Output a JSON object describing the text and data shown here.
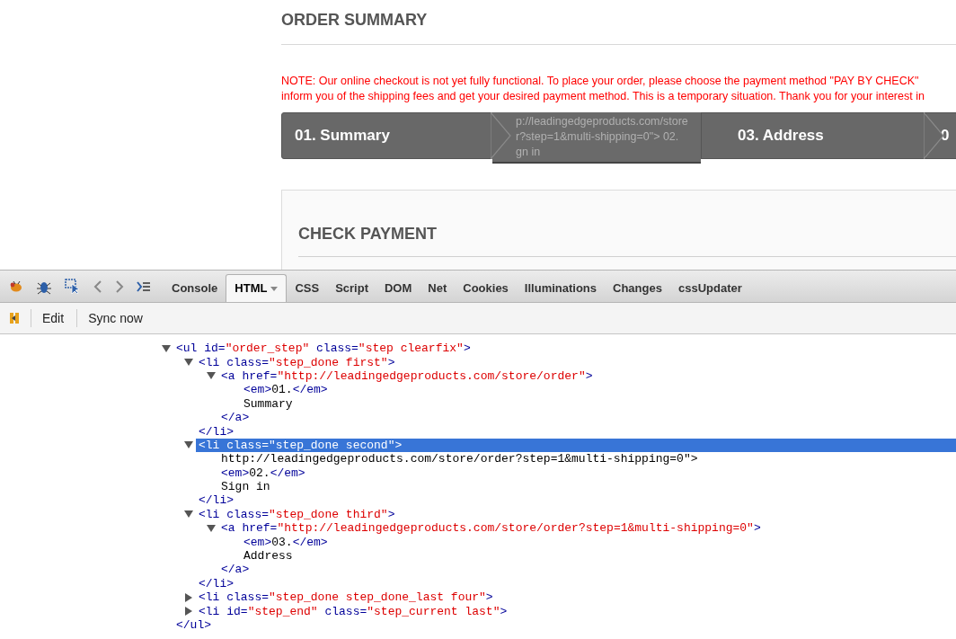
{
  "page": {
    "title": "ORDER SUMMARY",
    "note_lines": [
      "NOTE: Our online checkout is not yet fully functional. To place your order, please choose the payment method \"PAY BY CHECK\"",
      "inform you of the shipping fees and get your desired payment method. This is a temporary situation. Thank you for your interest in"
    ],
    "steps": [
      {
        "kind": "step",
        "lines": [
          "01. Summary"
        ]
      },
      {
        "kind": "overlay",
        "lines": [
          "p://leadingedgeproducts.com/store",
          "r?step=1&multi-shipping=0\"> 02.",
          "gn in"
        ]
      },
      {
        "kind": "step",
        "lines": [
          "03. Address"
        ]
      },
      {
        "kind": "step",
        "lines": [
          "0"
        ]
      }
    ],
    "panel": {
      "title": "CHECK PAYMENT"
    }
  },
  "devtools": {
    "tabs": [
      {
        "label": "Console",
        "selected": false,
        "menu": false
      },
      {
        "label": "HTML",
        "selected": true,
        "menu": true
      },
      {
        "label": "CSS",
        "selected": false,
        "menu": false
      },
      {
        "label": "Script",
        "selected": false,
        "menu": false
      },
      {
        "label": "DOM",
        "selected": false,
        "menu": false
      },
      {
        "label": "Net",
        "selected": false,
        "menu": false
      },
      {
        "label": "Cookies",
        "selected": false,
        "menu": false
      },
      {
        "label": "Illuminations",
        "selected": false,
        "menu": false
      },
      {
        "label": "Changes",
        "selected": false,
        "menu": false
      },
      {
        "label": "cssUpdater",
        "selected": false,
        "menu": false
      }
    ],
    "subtoolbar": [
      "Edit",
      "Sync now"
    ],
    "tree": [
      {
        "expanded": true,
        "selected": false,
        "tokens": [
          {
            "kind": "tag",
            "text": "<ul"
          },
          {
            "kind": "attr",
            "text": " id="
          },
          {
            "kind": "value",
            "text": "\"order_step\""
          },
          {
            "kind": "attr",
            "text": " class="
          },
          {
            "kind": "value",
            "text": "\"step clearfix\""
          },
          {
            "kind": "tag",
            "text": ">"
          }
        ],
        "close": [
          {
            "kind": "tag",
            "text": "</ul>"
          }
        ],
        "children": [
          {
            "expanded": true,
            "selected": false,
            "tokens": [
              {
                "kind": "tag",
                "text": "<li"
              },
              {
                "kind": "attr",
                "text": " class="
              },
              {
                "kind": "value",
                "text": "\"step_done first\""
              },
              {
                "kind": "tag",
                "text": ">"
              }
            ],
            "close": [
              {
                "kind": "tag",
                "text": "</li>"
              }
            ],
            "children": [
              {
                "expanded": true,
                "selected": false,
                "tokens": [
                  {
                    "kind": "tag",
                    "text": "<a"
                  },
                  {
                    "kind": "attr",
                    "text": " href="
                  },
                  {
                    "kind": "value",
                    "text": "\"http://leadingedgeproducts.com/store/order\""
                  },
                  {
                    "kind": "tag",
                    "text": ">"
                  }
                ],
                "close": [
                  {
                    "kind": "tag",
                    "text": "</a>"
                  }
                ],
                "children": [
                  {
                    "tokens": [
                      {
                        "kind": "tag",
                        "text": "<em>"
                      },
                      {
                        "kind": "text",
                        "text": "01."
                      },
                      {
                        "kind": "tag",
                        "text": "</em>"
                      }
                    ]
                  },
                  {
                    "tokens": [
                      {
                        "kind": "text",
                        "text": "Summary"
                      }
                    ]
                  }
                ]
              }
            ]
          },
          {
            "expanded": true,
            "selected": true,
            "tokens": [
              {
                "kind": "tag",
                "text": "<li"
              },
              {
                "kind": "attr",
                "text": " class="
              },
              {
                "kind": "value",
                "text": "\"step_done second\""
              },
              {
                "kind": "tag",
                "text": ">"
              }
            ],
            "close": [
              {
                "kind": "tag",
                "text": "</li>"
              }
            ],
            "children": [
              {
                "tokens": [
                  {
                    "kind": "text",
                    "text": "http://leadingedgeproducts.com/store/order?step=1&multi-shipping=0\">"
                  }
                ]
              },
              {
                "tokens": [
                  {
                    "kind": "tag",
                    "text": "<em>"
                  },
                  {
                    "kind": "text",
                    "text": "02."
                  },
                  {
                    "kind": "tag",
                    "text": "</em>"
                  }
                ]
              },
              {
                "tokens": [
                  {
                    "kind": "text",
                    "text": "Sign in"
                  }
                ]
              }
            ]
          },
          {
            "expanded": true,
            "selected": false,
            "tokens": [
              {
                "kind": "tag",
                "text": "<li"
              },
              {
                "kind": "attr",
                "text": " class="
              },
              {
                "kind": "value",
                "text": "\"step_done third\""
              },
              {
                "kind": "tag",
                "text": ">"
              }
            ],
            "close": [
              {
                "kind": "tag",
                "text": "</li>"
              }
            ],
            "children": [
              {
                "expanded": true,
                "selected": false,
                "tokens": [
                  {
                    "kind": "tag",
                    "text": "<a"
                  },
                  {
                    "kind": "attr",
                    "text": " href="
                  },
                  {
                    "kind": "value",
                    "text": "\"http://leadingedgeproducts.com/store/order?step=1&multi-shipping=0\""
                  },
                  {
                    "kind": "tag",
                    "text": ">"
                  }
                ],
                "close": [
                  {
                    "kind": "tag",
                    "text": "</a>"
                  }
                ],
                "children": [
                  {
                    "tokens": [
                      {
                        "kind": "tag",
                        "text": "<em>"
                      },
                      {
                        "kind": "text",
                        "text": "03."
                      },
                      {
                        "kind": "tag",
                        "text": "</em>"
                      }
                    ]
                  },
                  {
                    "tokens": [
                      {
                        "kind": "text",
                        "text": "Address"
                      }
                    ]
                  }
                ]
              }
            ]
          },
          {
            "expanded": false,
            "selected": false,
            "tokens": [
              {
                "kind": "tag",
                "text": "<li"
              },
              {
                "kind": "attr",
                "text": " class="
              },
              {
                "kind": "value",
                "text": "\"step_done step_done_last four\""
              },
              {
                "kind": "tag",
                "text": ">"
              }
            ]
          },
          {
            "expanded": false,
            "selected": false,
            "tokens": [
              {
                "kind": "tag",
                "text": "<li"
              },
              {
                "kind": "attr",
                "text": " id="
              },
              {
                "kind": "value",
                "text": "\"step_end\""
              },
              {
                "kind": "attr",
                "text": " class="
              },
              {
                "kind": "value",
                "text": "\"step_current last\""
              },
              {
                "kind": "tag",
                "text": ">"
              }
            ]
          }
        ]
      }
    ]
  }
}
